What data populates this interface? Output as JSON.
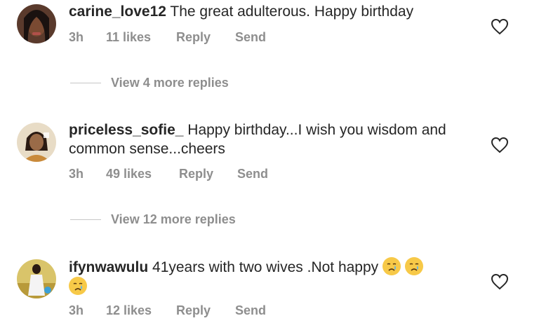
{
  "comments": [
    {
      "username": "carine_love12",
      "text": " The great adulterous. Happy birthday",
      "time": "3h",
      "likes": "11 likes",
      "reply": "Reply",
      "send": "Send"
    },
    {
      "username": "priceless_sofie_",
      "text": " Happy birthday...I wish you wisdom and common sense...cheers",
      "time": "3h",
      "likes": "49 likes",
      "reply": "Reply",
      "send": "Send"
    },
    {
      "username": "ifynwawulu",
      "text": " 41years with two wives .Not happy",
      "time": "3h",
      "likes": "12 likes",
      "reply": "Reply",
      "send": "Send"
    }
  ],
  "view_more": [
    "View 4 more replies",
    "View 12 more replies"
  ],
  "icons": {
    "like": "heart-outline-icon",
    "emoji": "crying-face-emoji"
  },
  "colors": {
    "text": "#262626",
    "meta": "#8e8e8e"
  }
}
